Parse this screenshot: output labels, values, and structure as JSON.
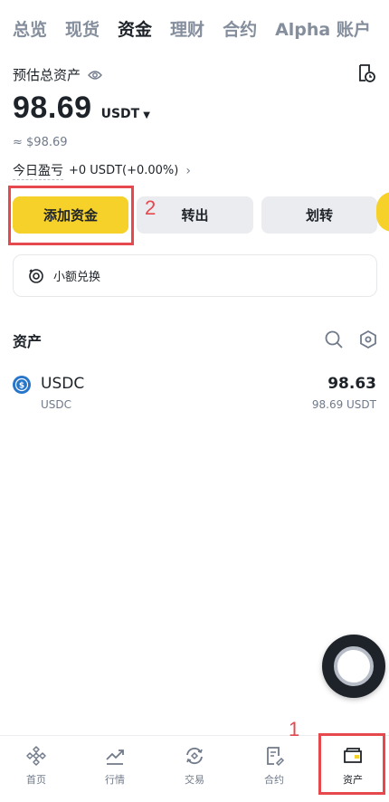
{
  "top_tabs": [
    {
      "label": "总览",
      "active": false
    },
    {
      "label": "现货",
      "active": false
    },
    {
      "label": "资金",
      "active": true
    },
    {
      "label": "理财",
      "active": false
    },
    {
      "label": "合约",
      "active": false
    },
    {
      "label": "Alpha 账户",
      "active": false
    }
  ],
  "summary": {
    "estimated_label": "预估总资产",
    "balance": "98.69",
    "unit": "USDT",
    "fiat_value": "≈ $98.69",
    "pnl_label": "今日盈亏",
    "pnl_value": "+0 USDT(+0.00%)"
  },
  "actions": {
    "add_funds": "添加资金",
    "transfer_out": "转出",
    "transfer": "划转"
  },
  "annotations": {
    "marker_1": "1",
    "marker_2": "2"
  },
  "small_exchange": {
    "label": "小额兑换"
  },
  "assets": {
    "title": "资产",
    "items": [
      {
        "symbol": "USDC",
        "name": "USDC",
        "amount": "98.63",
        "value": "98.69 USDT"
      }
    ]
  },
  "bottom_nav": [
    {
      "label": "首页",
      "icon": "home-icon",
      "active": false
    },
    {
      "label": "行情",
      "icon": "markets-icon",
      "active": false
    },
    {
      "label": "交易",
      "icon": "trade-icon",
      "active": false
    },
    {
      "label": "合约",
      "icon": "futures-icon",
      "active": false
    },
    {
      "label": "资产",
      "icon": "wallet-icon",
      "active": true
    }
  ],
  "colors": {
    "accent_yellow": "#F6D129",
    "highlight_red": "#E5484D",
    "text_primary": "#1E2329",
    "text_secondary": "#707A8A",
    "usdc_blue": "#2775CA"
  }
}
